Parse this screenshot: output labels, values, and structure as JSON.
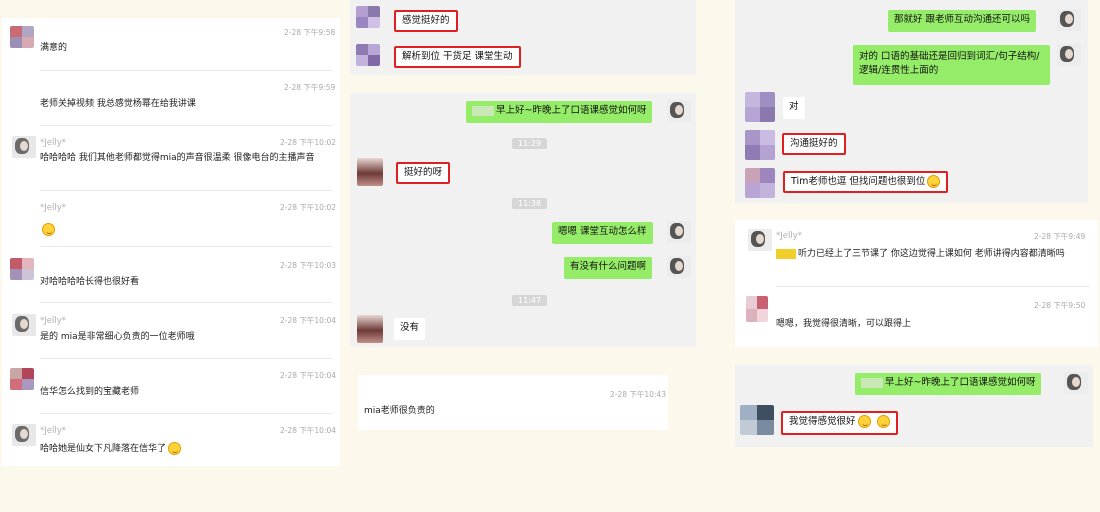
{
  "colors": {
    "bg": "#fdf8ec",
    "sent_bubble": "#95ec69",
    "highlight_border": "#e02020",
    "time_pill": "#d6d6d6"
  },
  "left_panel": {
    "messages": [
      {
        "name": "",
        "time": "2-28 下午9:58",
        "text": "满意的"
      },
      {
        "name": "",
        "time": "2-28 下午9:59",
        "text": "老师关掉视频 我总感觉杨幂在给我讲课"
      },
      {
        "name": "*Jelly*",
        "time": "2-28 下午10:02",
        "text": "哈哈哈哈 我们其他老师都觉得mia的声音很温柔 很像电台的主播声音"
      },
      {
        "name": "*Jelly*",
        "time": "2-28 下午10:02",
        "text": "",
        "emoji": "smile-emoji"
      },
      {
        "name": "",
        "time": "2-28 下午10:03",
        "text": "对哈哈哈哈长得也很好看"
      },
      {
        "name": "*Jelly*",
        "time": "2-28 下午10:04",
        "text": "是的 mia是非常细心负责的一位老师哦"
      },
      {
        "name": "",
        "time": "2-28 下午10:04",
        "text": "信华怎么找到的宝藏老师"
      },
      {
        "name": "*Jelly*",
        "time": "2-28 下午10:04",
        "text": "哈哈她是仙女下凡降落在信华了",
        "emoji": "grin-emoji"
      }
    ]
  },
  "middle_top": {
    "b1": "感觉挺好的",
    "b2": "解析到位 干货足 课堂生动"
  },
  "middle_chat": {
    "sent1": "早上好~昨晚上了口语课感觉如何呀",
    "t1": "11:29",
    "recv1": "挺好的呀",
    "t2": "11:38",
    "sent2": "嗯嗯 课堂互动怎么样",
    "sent3": "有没有什么问题啊",
    "t3": "11:47",
    "recv2": "没有"
  },
  "middle_bottom": {
    "time": "2-28 下午10:43",
    "text": "mia老师很负责的"
  },
  "right_top": {
    "sent1": "那就好 跟老师互动沟通还可以吗",
    "sent2": "对的 口语的基础还是回归到词汇/句子结构/逻辑/连贯性上面的",
    "recv1": "对",
    "recv2": "沟通挺好的",
    "recv3": "Tim老师也逗 但找问题也很到位"
  },
  "right_middle": {
    "m1": {
      "name": "*Jelly*",
      "time": "2-28 下午9:49",
      "text": "听力已经上了三节课了 你这边觉得上课如何 老师讲得内容都清晰吗"
    },
    "m2": {
      "name": "",
      "time": "2-28 下午9:50",
      "text": "嗯嗯，我觉得很清晰，可以跟得上"
    }
  },
  "right_bottom": {
    "sent": "早上好~昨晚上了口语课感觉如何呀",
    "recv": "我觉得感觉很好"
  }
}
